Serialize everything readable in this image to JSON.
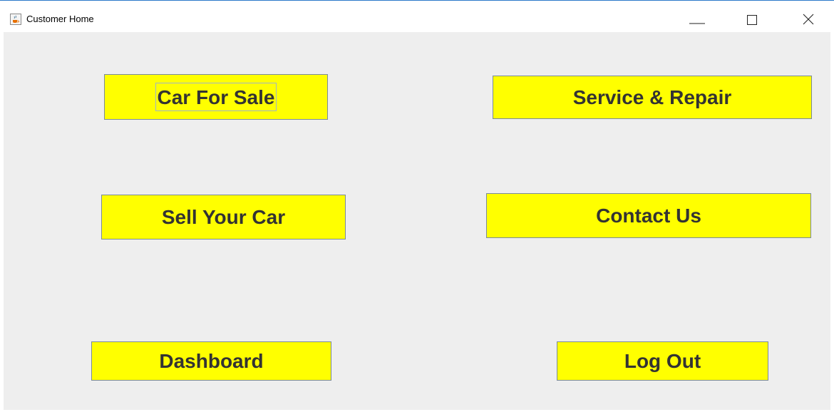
{
  "window": {
    "title": "Customer Home",
    "icon": "java-cup-icon",
    "controls": {
      "minimize": "minimize-icon",
      "maximize": "maximize-icon",
      "close": "close-icon"
    }
  },
  "colors": {
    "button_background": "#ffff00",
    "button_text": "#333333",
    "panel_background": "#eeeeee"
  },
  "buttons": {
    "car_for_sale": "Car For Sale",
    "service_repair": "Service & Repair",
    "sell_your_car": "Sell Your Car",
    "contact_us": "Contact Us",
    "dashboard": "Dashboard",
    "log_out": "Log Out"
  }
}
